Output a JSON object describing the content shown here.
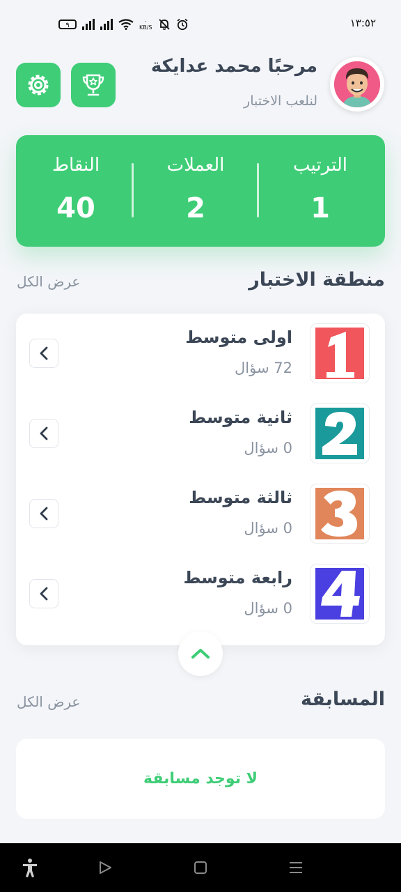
{
  "status_bar": {
    "time": "١٣:٥٢",
    "battery": "٩",
    "speed_unit": "KB/S",
    "speed_value": "٠"
  },
  "header": {
    "greeting": "مرحبًا محمد عدايكة",
    "subtitle": "لنلعب الاختبار",
    "settings_icon": "gear-icon",
    "trophy_icon": "trophy-icon"
  },
  "stats": [
    {
      "label": "الترتيب",
      "value": "1"
    },
    {
      "label": "العملات",
      "value": "2"
    },
    {
      "label": "النقاط",
      "value": "40"
    }
  ],
  "quiz_section": {
    "title": "منطقة الاختبار",
    "view_all": "عرض الكل",
    "items": [
      {
        "title": "اولى متوسط",
        "count": "72 سؤال",
        "number": "1",
        "color": "#f0565b"
      },
      {
        "title": "ثانية متوسط",
        "count": "0 سؤال",
        "number": "2",
        "color": "#1a9a9a"
      },
      {
        "title": "ثالثة متوسط",
        "count": "0 سؤال",
        "number": "3",
        "color": "#e0865a"
      },
      {
        "title": "رابعة متوسط",
        "count": "0 سؤال",
        "number": "4",
        "color": "#4a3fe0"
      }
    ]
  },
  "competition_section": {
    "title": "المسابقة",
    "view_all": "عرض الكل",
    "empty_text": "لا توجد مسابقة"
  },
  "colors": {
    "accent": "#3ecd76",
    "text_dark": "#3b4656",
    "text_muted": "#8a93a0",
    "background": "#f3f5f8"
  }
}
